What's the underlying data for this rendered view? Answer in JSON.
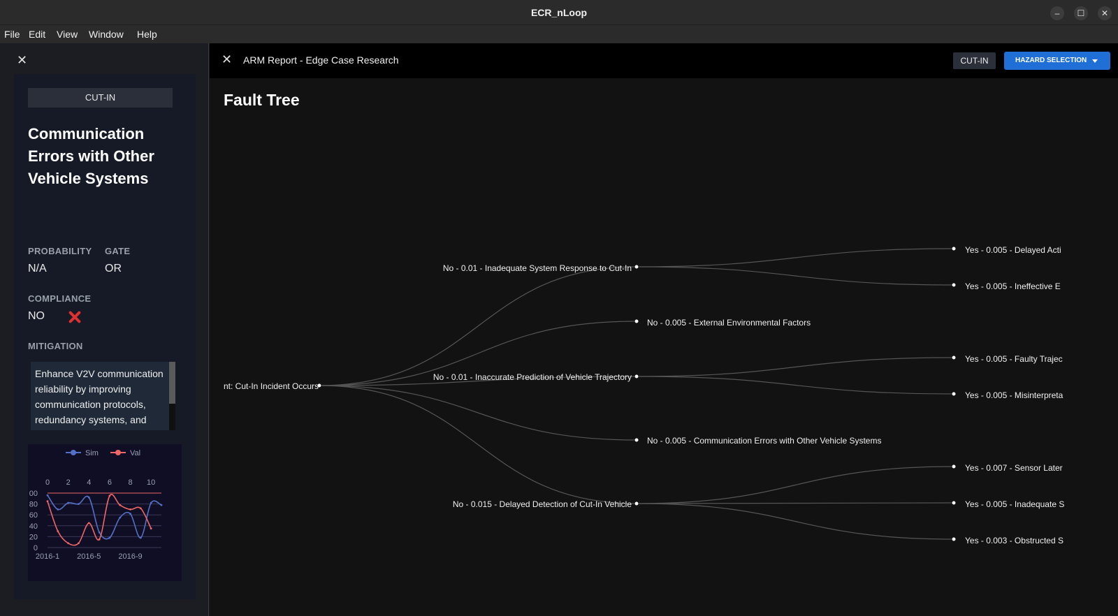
{
  "window": {
    "title": "ECR_nLoop",
    "minimize": "–",
    "maximize": "☐",
    "close": "✕"
  },
  "menu": [
    "File",
    "Edit",
    "View",
    "Window",
    "Help"
  ],
  "left_panel": {
    "close": "✕",
    "tag": "CUT-IN",
    "hazard_title": "Communication Errors with Other Vehicle Systems",
    "probability_label": "PROBABILITY",
    "probability_value": "N/A",
    "gate_label": "GATE",
    "gate_value": "OR",
    "compliance_label": "COMPLIANCE",
    "compliance_value": "NO",
    "compliance_icon": "cross-mark-icon",
    "mitigation_label": "MITIGATION",
    "mitigation_text": "Enhance V2V communication reliability by improving communication protocols, redundancy systems, and developing protocols to minimize errors."
  },
  "mini_chart": {
    "chart_data": {
      "type": "line",
      "legend": [
        "Sim",
        "Val"
      ],
      "legend_position": "top",
      "top_axis_ticks": [
        "0",
        "2",
        "4",
        "6",
        "8",
        "10"
      ],
      "y_ticks": [
        "00",
        "80",
        "60",
        "40",
        "20",
        "0"
      ],
      "x_ticks": [
        "2016-1",
        "2016-5",
        "2016-9"
      ],
      "ylim": [
        0,
        100
      ],
      "xlim": [
        0,
        11
      ],
      "series": [
        {
          "name": "Sim",
          "color": "#5470c6",
          "values": [
            96,
            70,
            82,
            80,
            92,
            28,
            18,
            55,
            62,
            18,
            82,
            78
          ]
        },
        {
          "name": "Val",
          "color": "#ee6666",
          "values": [
            85,
            30,
            8,
            8,
            45,
            15,
            95,
            78,
            70,
            72,
            35
          ]
        }
      ]
    }
  },
  "main": {
    "close": "✕",
    "report_title": "ARM Report - Edge Case Research",
    "chip": "CUT-IN",
    "hazard_button": "HAZARD SELECTION",
    "heading": "Fault Tree"
  },
  "fault_tree": {
    "root": "nt: Cut-In Incident Occurs",
    "level1": [
      "No - 0.01 - Inadequate System Response to Cut-In",
      "No - 0.005 - External Environmental Factors",
      "No - 0.01 - Inaccurate Prediction of Vehicle Trajectory",
      "No - 0.005 - Communication Errors with Other Vehicle Systems",
      "No - 0.015 - Delayed Detection of Cut-In Vehicle"
    ],
    "level2": [
      "Yes - 0.005 - Delayed Acti",
      "Yes - 0.005 - Ineffective E",
      "Yes - 0.005 - Faulty Trajec",
      "Yes - 0.005 - Misinterpreta",
      "Yes - 0.007 - Sensor Later",
      "Yes - 0.005 - Inadequate S",
      "Yes - 0.003 - Obstructed S"
    ]
  }
}
